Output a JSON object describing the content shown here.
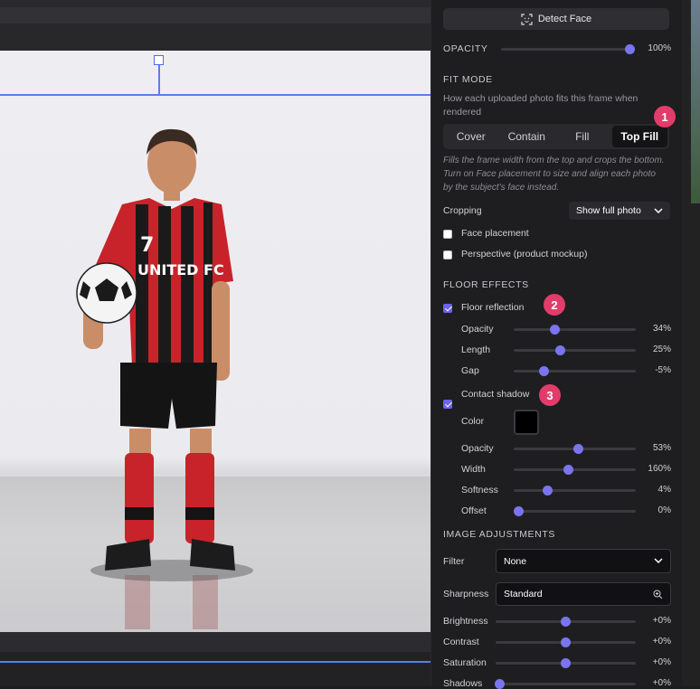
{
  "panel": {
    "detect_face_label": "Detect Face",
    "opacity": {
      "label": "OPACITY",
      "value": "100%",
      "fraction": 1.0
    },
    "fit_mode": {
      "title": "FIT MODE",
      "description": "How each uploaded photo fits this frame when rendered",
      "options": [
        "Cover",
        "Contain",
        "Fill",
        "Top Fill"
      ],
      "selected": "Top Fill",
      "help": "Fills the frame width from the top and crops the bottom. Turn on Face placement to size and align each photo by the subject's face instead."
    },
    "cropping": {
      "label": "Cropping",
      "value": "Show full photo"
    },
    "face_placement": {
      "label": "Face placement",
      "checked": false
    },
    "perspective": {
      "label": "Perspective (product mockup)",
      "checked": false
    },
    "floor_effects": {
      "title": "FLOOR EFFECTS",
      "reflection": {
        "label": "Floor reflection",
        "checked": true,
        "sliders": [
          {
            "label": "Opacity",
            "value": "34%",
            "fraction": 0.34
          },
          {
            "label": "Length",
            "value": "25%",
            "fraction": 0.38
          },
          {
            "label": "Gap",
            "value": "-5%",
            "fraction": 0.25
          }
        ]
      },
      "shadow": {
        "label": "Contact shadow",
        "checked": true,
        "color_label": "Color",
        "color": "#000000",
        "sliders": [
          {
            "label": "Opacity",
            "value": "53%",
            "fraction": 0.53
          },
          {
            "label": "Width",
            "value": "160%",
            "fraction": 0.45
          },
          {
            "label": "Softness",
            "value": "4%",
            "fraction": 0.28
          },
          {
            "label": "Offset",
            "value": "0%",
            "fraction": 0.04
          }
        ]
      }
    },
    "image_adjustments": {
      "title": "IMAGE ADJUSTMENTS",
      "filter": {
        "label": "Filter",
        "value": "None"
      },
      "sharpness": {
        "label": "Sharpness",
        "value": "Standard"
      },
      "sliders": [
        {
          "label": "Brightness",
          "value": "+0%",
          "fraction": 0.5
        },
        {
          "label": "Contrast",
          "value": "+0%",
          "fraction": 0.5
        },
        {
          "label": "Saturation",
          "value": "+0%",
          "fraction": 0.5
        },
        {
          "label": "Shadows",
          "value": "+0%",
          "fraction": 0.03
        }
      ]
    },
    "badges": [
      "1",
      "2",
      "3"
    ]
  },
  "photo": {
    "jersey_number": "7",
    "jersey_text": "UNITED FC"
  },
  "colors": {
    "accent": "#7b74ef",
    "badge": "#e23c6a",
    "guide": "#5b7cf0"
  }
}
